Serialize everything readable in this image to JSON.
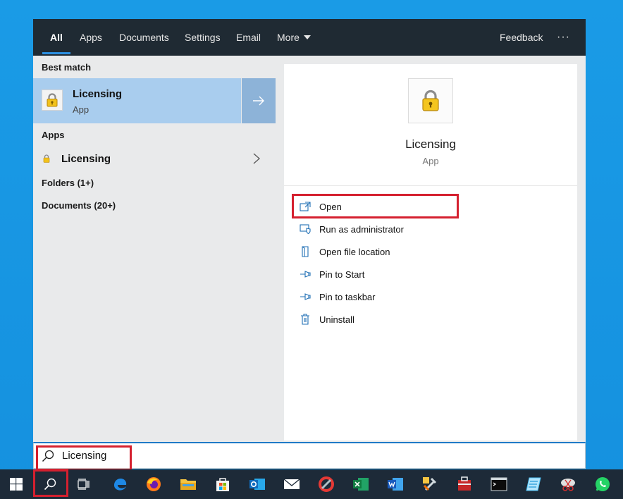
{
  "tabs": [
    {
      "label": "All"
    },
    {
      "label": "Apps"
    },
    {
      "label": "Documents"
    },
    {
      "label": "Settings"
    },
    {
      "label": "Email"
    },
    {
      "label": "More"
    }
  ],
  "header": {
    "feedback_label": "Feedback",
    "more_options": "···"
  },
  "results": {
    "best_match_label": "Best match",
    "best_match": {
      "title": "Licensing",
      "subtitle": "App"
    },
    "apps_label": "Apps",
    "apps_item": "Licensing",
    "folders_label": "Folders (1+)",
    "documents_label": "Documents (20+)"
  },
  "detail": {
    "title": "Licensing",
    "subtitle": "App",
    "actions": [
      {
        "label": "Open",
        "icon": "open-icon"
      },
      {
        "label": "Run as administrator",
        "icon": "shield-icon"
      },
      {
        "label": "Open file location",
        "icon": "file-location-icon"
      },
      {
        "label": "Pin to Start",
        "icon": "pin-icon"
      },
      {
        "label": "Pin to taskbar",
        "icon": "pin-icon"
      },
      {
        "label": "Uninstall",
        "icon": "trash-icon"
      }
    ]
  },
  "search": {
    "query": "Licensing"
  },
  "colors": {
    "accent": "#1f7ac7",
    "highlight": "#d5202f",
    "selected": "#a9cdee",
    "taskbar": "#1d2a38"
  }
}
